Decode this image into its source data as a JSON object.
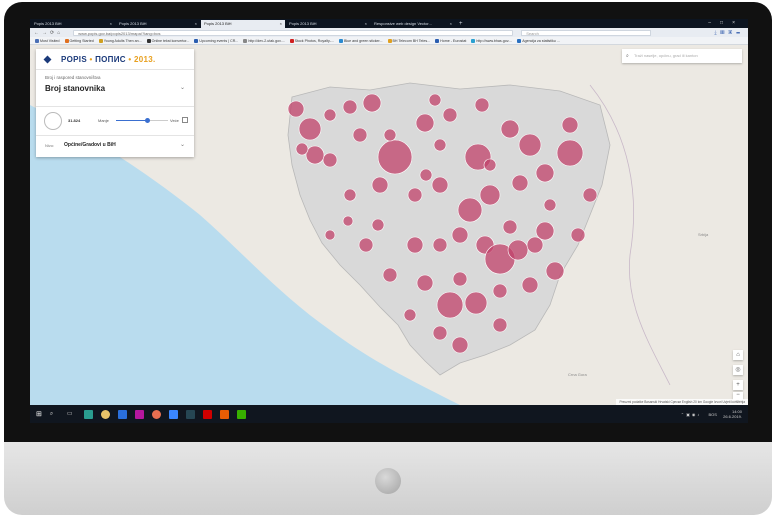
{
  "browser": {
    "tabs": [
      {
        "label": "Popis 2013 BiH",
        "active": false
      },
      {
        "label": "Popis 2013 BiH",
        "active": false
      },
      {
        "label": "Popis 2013 BiH",
        "active": true
      },
      {
        "label": "Popis 2013 BiH",
        "active": false
      },
      {
        "label": "Responsive web design Vector...",
        "active": false
      }
    ],
    "url": "www.popis.gov.ba/popis2013/mapa/?lang=bos",
    "search_placeholder": "Search",
    "bookmarks": [
      {
        "label": "Most Visited",
        "color": "#4a6fb5"
      },
      {
        "label": "Getting Started",
        "color": "#e07020"
      },
      {
        "label": "Young Adults Then an...",
        "color": "#d0a020"
      },
      {
        "label": "Online tekst konvertor...",
        "color": "#333333"
      },
      {
        "label": "Upcoming events | CR...",
        "color": "#2a5db0"
      },
      {
        "label": "http://dev-2.utak.gov....",
        "color": "#888888"
      },
      {
        "label": "Stock Photos, Royalty-...",
        "color": "#d02020"
      },
      {
        "label": "Blue and green sticker...",
        "color": "#2a8ad0"
      },
      {
        "label": "BH Telecom BH Teles...",
        "color": "#e0a020"
      },
      {
        "label": "Home - Eurostat",
        "color": "#2a5db0"
      },
      {
        "label": "http://www.bhas.gov....",
        "color": "#2aa0d0"
      },
      {
        "label": "Agencija za statistiku ...",
        "color": "#2a70c0"
      }
    ]
  },
  "panel": {
    "logo_a": "POPIS",
    "logo_sep": " • ",
    "logo_b": "ПОПИС",
    "logo_year": " • 2013.",
    "select_sub": "Broj i raspored stanovništva",
    "select_main": "Broj stanovnika",
    "legend_value": "31.824",
    "legend_min": "Manje",
    "legend_max": "Veće",
    "slider_fraction": 0.6,
    "level_label": "Nivo:",
    "level_value": "Općine/Gradovi u BiH"
  },
  "map": {
    "search_placeholder": "Traži naselje, općinu, grad ili kanton",
    "labels": {
      "serbia": "Srbija",
      "montenegro": "Crna Gora"
    },
    "attribution": "Preuzmi podatke  Bosanski  Hrvatski  Српски  English      20 km  Google Izvori  Uvjeti korištenja",
    "bubble_color": "#c0426a",
    "land_color": "#d9d9d9",
    "water_color": "#b9dcee"
  },
  "taskbar": {
    "time": "14:00",
    "date": "26.6.2019.",
    "lang": "BOS"
  }
}
